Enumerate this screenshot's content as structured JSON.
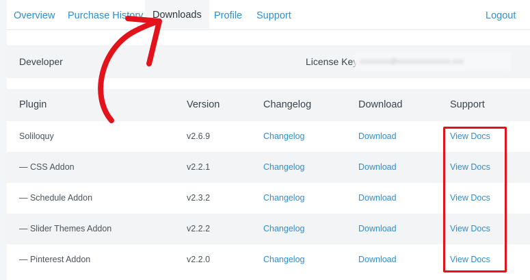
{
  "nav": {
    "overview": "Overview",
    "purchase_history": "Purchase History",
    "downloads": "Downloads",
    "profile": "Profile",
    "support": "Support",
    "logout": "Logout"
  },
  "license": {
    "developer": "Developer",
    "key_label": "License Key:",
    "key_value": "xxxxxxxx@xxxxxxxxxxxxxx.xxx"
  },
  "table": {
    "headers": {
      "plugin": "Plugin",
      "version": "Version",
      "changelog": "Changelog",
      "download": "Download",
      "support": "Support"
    },
    "rows": [
      {
        "plugin": "Soliloquy",
        "version": "v2.6.9",
        "changelog": "Changelog",
        "download": "Download",
        "support": "View Docs"
      },
      {
        "plugin": "— CSS Addon",
        "version": "v2.2.1",
        "changelog": "Changelog",
        "download": "Download",
        "support": "View Docs"
      },
      {
        "plugin": "— Schedule Addon",
        "version": "v2.3.2",
        "changelog": "Changelog",
        "download": "Download",
        "support": "View Docs"
      },
      {
        "plugin": "— Slider Themes Addon",
        "version": "v2.2.2",
        "changelog": "Changelog",
        "download": "Download",
        "support": "View Docs"
      },
      {
        "plugin": "— Pinterest Addon",
        "version": "v2.2.0",
        "changelog": "Changelog",
        "download": "Download",
        "support": "View Docs"
      }
    ]
  },
  "colors": {
    "link": "#2f8ecf",
    "annotation": "#e3131b"
  },
  "annotations": [
    "red-arrow-pointing-to-downloads-tab",
    "red-box-around-view-docs-column"
  ]
}
